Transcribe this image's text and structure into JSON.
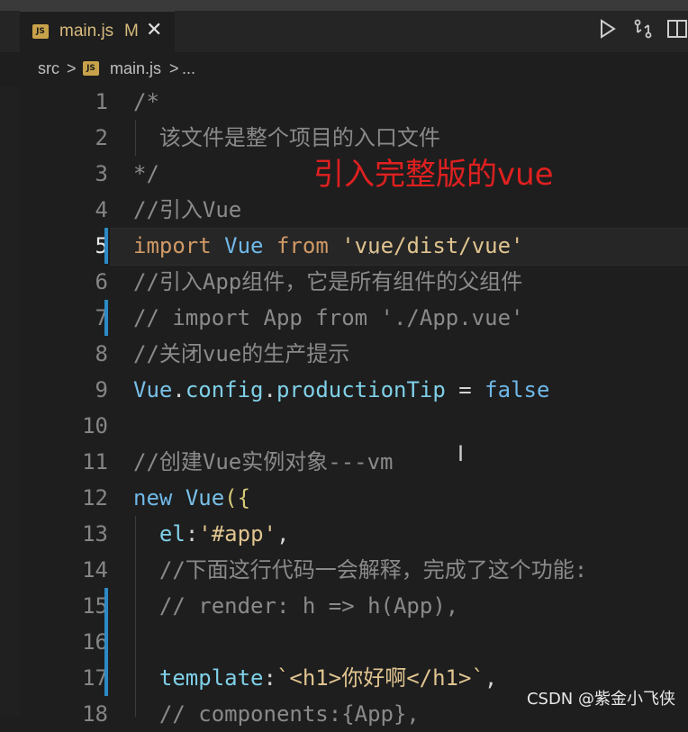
{
  "tab": {
    "icon_label": "JS",
    "file_name": "main.js",
    "modified_marker": "M",
    "close_glyph": "✕"
  },
  "actions": [
    "run-icon",
    "compare-changes-icon",
    "split-editor-icon"
  ],
  "breadcrumb": {
    "folder": "src",
    "sep1": ">",
    "file": "main.js",
    "sep2": ">",
    "more": "..."
  },
  "line_numbers": [
    "1",
    "2",
    "3",
    "4",
    "5",
    "6",
    "7",
    "8",
    "9",
    "10",
    "11",
    "12",
    "13",
    "14",
    "15",
    "16",
    "17",
    "18"
  ],
  "active_line": "5",
  "code": {
    "l1": {
      "comment": "/*"
    },
    "l2": {
      "comment": "  该文件是整个项目的入口文件"
    },
    "l3": {
      "comment": "*/"
    },
    "l4": {
      "comment": "//引入Vue"
    },
    "l5": {
      "kw_import": "import",
      "sp1": " ",
      "ident": "Vue",
      "sp2": " ",
      "kw_from": "from",
      "sp3": " ",
      "string": "'vue/dist/vue'"
    },
    "l6": {
      "comment": "//引入App组件，它是所有组件的父组件"
    },
    "l7": {
      "comment": "// import App from './App.vue'"
    },
    "l8": {
      "comment": "//关闭vue的生产提示"
    },
    "l9": {
      "obj": "Vue",
      "dot1": ".",
      "prop1": "config",
      "dot2": ".",
      "prop2": "productionTip",
      "op": " = ",
      "value": "false"
    },
    "l10": {
      "text": ""
    },
    "l11": {
      "comment": "//创建Vue实例对象---vm"
    },
    "l12": {
      "kw_new": "new",
      "sp": " ",
      "ident": "Vue",
      "open": "({"
    },
    "l13": {
      "indent": "  ",
      "key": "el",
      "colon": ":",
      "string": "'#app'",
      "comma": ","
    },
    "l14": {
      "comment": "  //下面这行代码一会解释，完成了这个功能:"
    },
    "l15": {
      "comment": "  // render: h => h(App),"
    },
    "l16": {
      "text": ""
    },
    "l17": {
      "indent": "  ",
      "key": "template",
      "colon": ":",
      "string": "`<h1>你好啊</h1>`",
      "comma": ","
    },
    "l18": {
      "comment": "  // components:{App},"
    }
  },
  "annotation": "引入完整版的vue",
  "cursor_glyph": "I",
  "hover_dots": "...",
  "watermark": "CSDN @紫金小飞侠",
  "colors": {
    "annotation_red": "#e02020",
    "modified_bar": "#2b8bc6",
    "tab_text": "#d7ba7d",
    "keyword": "#d19a66",
    "type": "#6fb8e8",
    "comment": "#8a8a8a"
  }
}
